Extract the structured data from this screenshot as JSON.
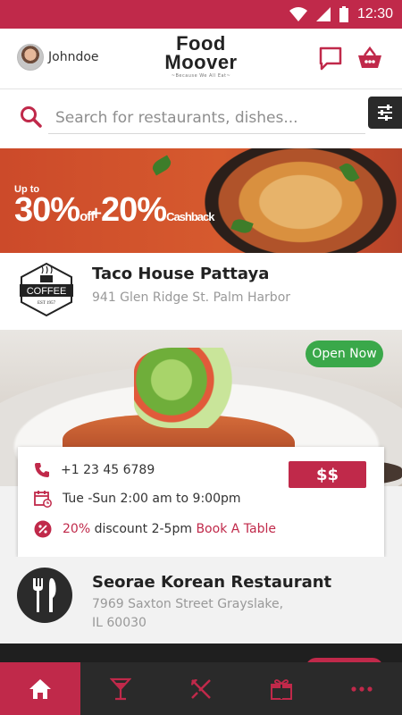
{
  "colors": {
    "brand": "#c0294a",
    "dark": "#2a2a2a",
    "open": "#3aa84a"
  },
  "status_bar": {
    "time": "12:30",
    "icons": [
      "wifi-icon",
      "signal-icon",
      "battery-icon"
    ]
  },
  "header": {
    "username": "Johndoe",
    "logo_line1": "Food",
    "logo_line2": "Moover",
    "logo_tagline": "~Because We All Eat~",
    "icons": [
      "chat-icon",
      "basket-icon"
    ]
  },
  "search": {
    "placeholder": "Search for restaurants, dishes..."
  },
  "banner": {
    "upto": "Up to",
    "discount_value": "30%",
    "discount_suffix": "off",
    "plus": "+",
    "cashback_value": "20%",
    "cashback_suffix": "Cashback"
  },
  "restaurants": [
    {
      "name": "Taco House Pattaya",
      "address": "941 Glen Ridge St. Palm Harbor",
      "logo_text": "COFFEE",
      "logo_sub": "EST 1957"
    },
    {
      "name": "",
      "status": "Open Now",
      "phone": "+1 23 45 6789",
      "hours": "Tue -Sun 2:00 am to 9:00pm",
      "discount_value": "20%",
      "discount_text": "discount 2-5pm",
      "book_label": "Book A Table",
      "price": "$$"
    },
    {
      "name": "Seorae Korean Restaurant",
      "address_line1": "7969 Saxton Street Grayslake,",
      "address_line2": "IL 60030"
    }
  ],
  "bottom_nav": [
    {
      "icon": "home-icon",
      "active": true
    },
    {
      "icon": "cocktail-icon",
      "active": false
    },
    {
      "icon": "cutlery-icon",
      "active": false
    },
    {
      "icon": "gift-icon",
      "active": false
    },
    {
      "icon": "more-icon",
      "active": false
    }
  ]
}
